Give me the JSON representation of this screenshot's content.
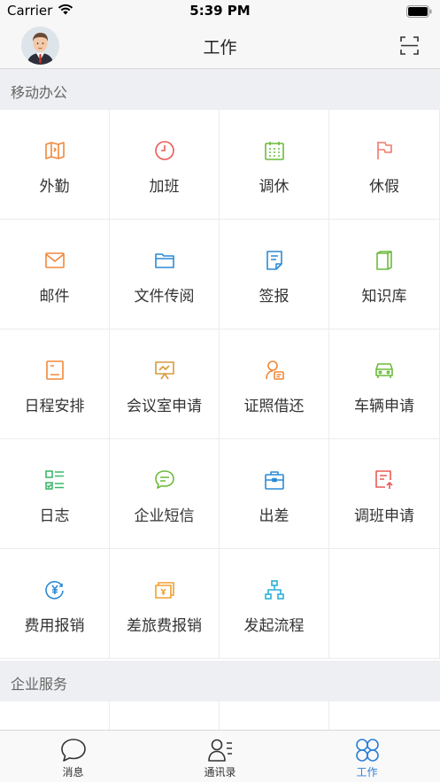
{
  "status_bar": {
    "carrier": "Carrier",
    "time": "5:39 PM"
  },
  "header": {
    "title": "工作"
  },
  "sections": {
    "mobile_office": "移动办公",
    "enterprise_services": "企业服务"
  },
  "grid_items": [
    {
      "label": "外勤",
      "icon": "map-icon",
      "color": "#f0883a"
    },
    {
      "label": "加班",
      "icon": "clock-icon",
      "color": "#ea5a55"
    },
    {
      "label": "调休",
      "icon": "calendar-icon",
      "color": "#6cbb3c"
    },
    {
      "label": "休假",
      "icon": "flag-icon",
      "color": "#ef7a6a"
    },
    {
      "label": "邮件",
      "icon": "mail-icon",
      "color": "#f0883a"
    },
    {
      "label": "文件传阅",
      "icon": "folder-icon",
      "color": "#2b8ad6"
    },
    {
      "label": "签报",
      "icon": "document-icon",
      "color": "#2b8ad6"
    },
    {
      "label": "知识库",
      "icon": "book-icon",
      "color": "#6cbb3c"
    },
    {
      "label": "日程安排",
      "icon": "schedule-icon",
      "color": "#f0883a"
    },
    {
      "label": "会议室申请",
      "icon": "presentation-icon",
      "color": "#d79a3a"
    },
    {
      "label": "证照借还",
      "icon": "certificate-icon",
      "color": "#f0883a"
    },
    {
      "label": "车辆申请",
      "icon": "car-icon",
      "color": "#6cbb3c"
    },
    {
      "label": "日志",
      "icon": "log-icon",
      "color": "#3cb96a"
    },
    {
      "label": "企业短信",
      "icon": "chat-icon",
      "color": "#6cbb3c"
    },
    {
      "label": "出差",
      "icon": "briefcase-icon",
      "color": "#2b8ad6"
    },
    {
      "label": "调班申请",
      "icon": "shift-icon",
      "color": "#ea5a55"
    },
    {
      "label": "费用报销",
      "icon": "yen-icon",
      "color": "#2b8ad6"
    },
    {
      "label": "差旅费报销",
      "icon": "money-icon",
      "color": "#f0a030"
    },
    {
      "label": "发起流程",
      "icon": "flowchart-icon",
      "color": "#2bb0d6"
    }
  ],
  "tabs": [
    {
      "label": "消息",
      "icon": "message-icon"
    },
    {
      "label": "通讯录",
      "icon": "contacts-icon"
    },
    {
      "label": "工作",
      "icon": "work-icon",
      "active": true
    }
  ],
  "colors": {
    "active_tab": "#2b7fd6",
    "section_bg": "#eeeff2"
  }
}
